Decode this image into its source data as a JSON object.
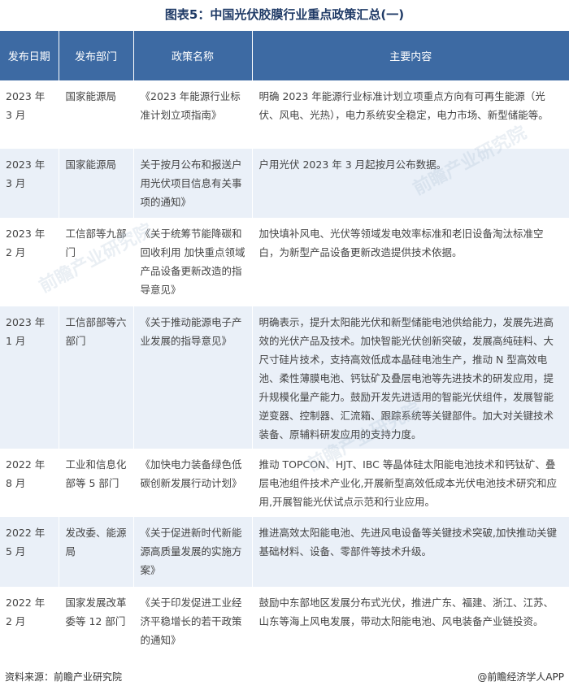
{
  "title": "图表5：中国光伏胶膜行业重点政策汇总(一)",
  "headers": [
    "发布日期",
    "发布部门",
    "政策名称",
    "主要内容"
  ],
  "rows": [
    {
      "date": "2023 年 3 月",
      "dept": "国家能源局",
      "name": "《2023 年能源行业标准计划立项指南》",
      "content": "明确 2023 年能源行业标准计划立项重点方向有可再生能源（光伏、风电、光热），电力系统安全稳定，电力市场、新型储能等。"
    },
    {
      "date": "2023 年 3 月",
      "dept": "国家能源局",
      "name": "关于按月公布和报送户用光伏项目信息有关事项的通知》",
      "content": "户用光伏 2023 年 3 月起按月公布数据。"
    },
    {
      "date": "2023 年 2 月",
      "dept": "工信部等九部门",
      "name": "《关于统筹节能降碳和回收利用 加快重点领域产品设备更新改造的指导意见》",
      "content": "加快填补风电、光伏等领域发电效率标准和老旧设备淘汰标准空白，为新型产品设备更新改造提供技术依据。"
    },
    {
      "date": "2023 年 1 月",
      "dept": "工信部部等六部门",
      "name": "《关于推动能源电子产业发展的指导意见》",
      "content": "明确表示，提升太阳能光伏和新型储能电池供给能力，发展先进高效的光伏产品及技术。加快智能光伏创新突破，发展高纯硅料、大尺寸硅片技术，支持高效低成本晶硅电池生产，推动 N 型高效电池、柔性薄膜电池、钙钛矿及叠层电池等先进技术的研发应用，提升规模化量产能力。鼓励开发先进适用的智能光伏组件，发展智能逆变器、控制器、汇流箱、跟踪系统等关键部件。加大对关键技术装备、原辅料研发应用的支持力度。"
    },
    {
      "date": "2022 年 8 月",
      "dept": "工业和信息化部等 5 部门",
      "name": "《加快电力装备绿色低碳创新发展行动计划》",
      "content": "推动 TOPCON、HJT、IBC 等晶体硅太阳能电池技术和钙钛矿、叠层电池组件技术产业化,开展新型高效低成本光伏电池技术研究和应用,开展智能光伏试点示范和行业应用。"
    },
    {
      "date": "2022 年 5 月",
      "dept": "发改委、能源局",
      "name": "《关于促进新时代新能源高质量发展的实施方案》",
      "content": "推进高效太阳能电池、先进风电设备等关键技术突破,加快推动关键基础材料、设备、零部件等技术升级。"
    },
    {
      "date": "2022 年 2 月",
      "dept": "国家发展改革委等 12 部门",
      "name": "《关于印发促进工业经济平稳增长的若干政策的通知》",
      "content": "鼓励中东部地区发展分布式光伏，推进广东、福建、浙江、江苏、山东等海上风电发展，带动太阳能电池、风电装备产业链投资。"
    }
  ],
  "footer": {
    "source": "资料来源：前瞻产业研究院",
    "brand": "@前瞻经济学人APP"
  },
  "watermark": "前瞻产业研究院"
}
